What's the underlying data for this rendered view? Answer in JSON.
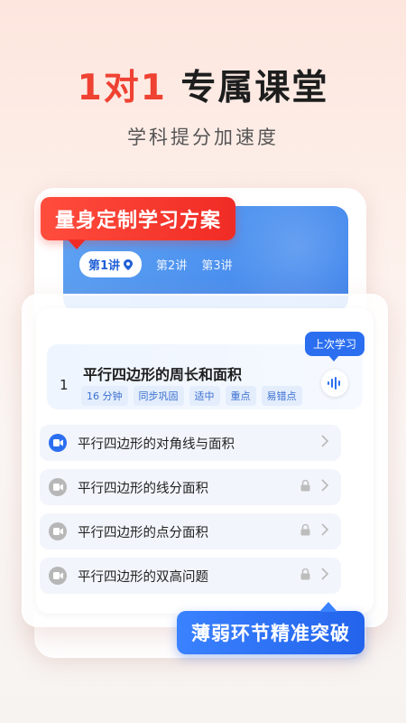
{
  "headline": {
    "accent": "1对1",
    "main": " 专属课堂"
  },
  "subtitle": "学科提分加速度",
  "banner_top": "量身定制学习方案",
  "lesson_tabs": [
    "第1讲",
    "第2讲",
    "第3讲"
  ],
  "last_study_badge": "上次学习",
  "lesson": {
    "number": "1",
    "title": "平行四边形的周长和面积",
    "tags": [
      "16 分钟",
      "同步巩固",
      "适中",
      "重点",
      "易错点"
    ]
  },
  "sub_lessons": [
    {
      "label": "平行四边形的对角线与面积",
      "locked": false
    },
    {
      "label": "平行四边形的线分面积",
      "locked": true
    },
    {
      "label": "平行四边形的点分面积",
      "locked": true
    },
    {
      "label": "平行四边形的双高问题",
      "locked": true
    }
  ],
  "banner_bottom": "薄弱环节精准突破",
  "colors": {
    "accent_red": "#ef4233",
    "accent_blue": "#2b6ff0"
  }
}
